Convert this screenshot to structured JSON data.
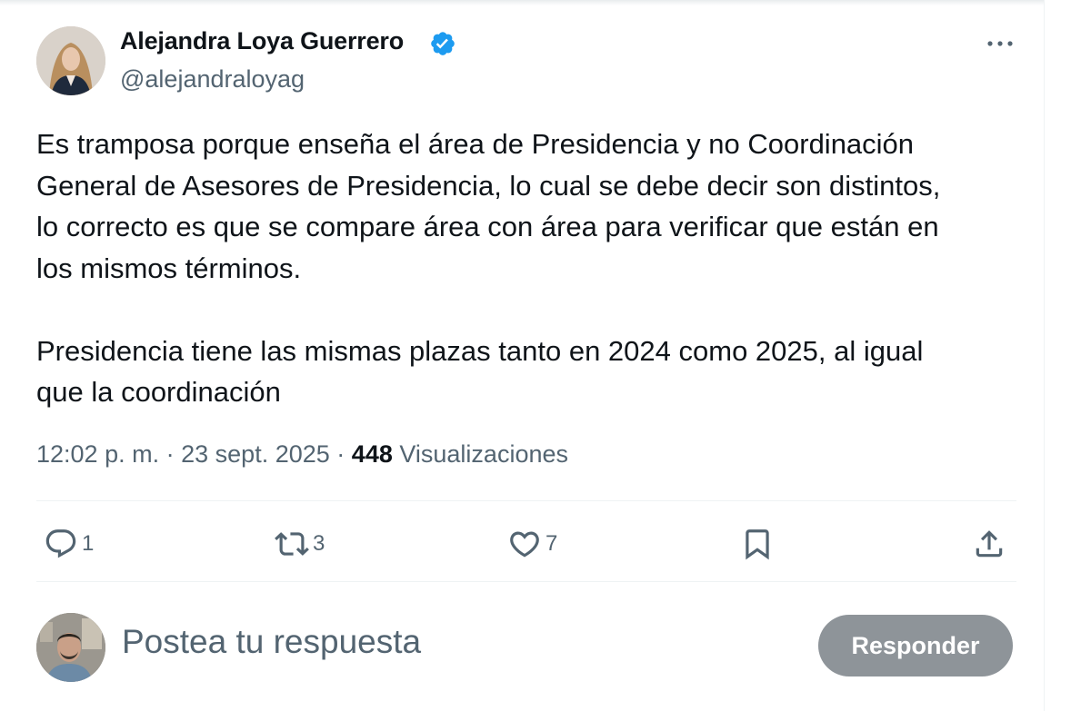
{
  "author": {
    "name": "Alejandra Loya Guerrero",
    "handle": "@alejandraloyag",
    "verified": true
  },
  "tweet": {
    "paragraphs": [
      [
        "Es tramposa porque enseña el área de Presidencia y no Coordinación",
        "General de Asesores de Presidencia, lo cual se debe decir son distintos,",
        "lo correcto es que se compare área con área para verificar que están en",
        "los mismos términos."
      ],
      [
        "Presidencia tiene las mismas plazas tanto en 2024 como 2025, al igual",
        "que la coordinación"
      ]
    ],
    "time": "12:02 p. m.",
    "date": "23 sept. 2025",
    "separator": "·",
    "views_count": "448",
    "views_label": "Visualizaciones"
  },
  "actions": {
    "replies": "1",
    "reposts": "3",
    "likes": "7"
  },
  "icons": {
    "verified": "verified-badge-icon",
    "more": "more-options-icon",
    "reply": "comment-icon",
    "repost": "repost-icon",
    "like": "heart-icon",
    "bookmark": "bookmark-icon",
    "share": "share-icon"
  },
  "composer": {
    "placeholder": "Postea tu respuesta",
    "button_label": "Responder"
  },
  "colors": {
    "text_primary": "#0f1419",
    "text_secondary": "#536471",
    "verified_blue": "#1d9bf0",
    "button_disabled": "#8e9499",
    "divider": "#eff3f4"
  }
}
